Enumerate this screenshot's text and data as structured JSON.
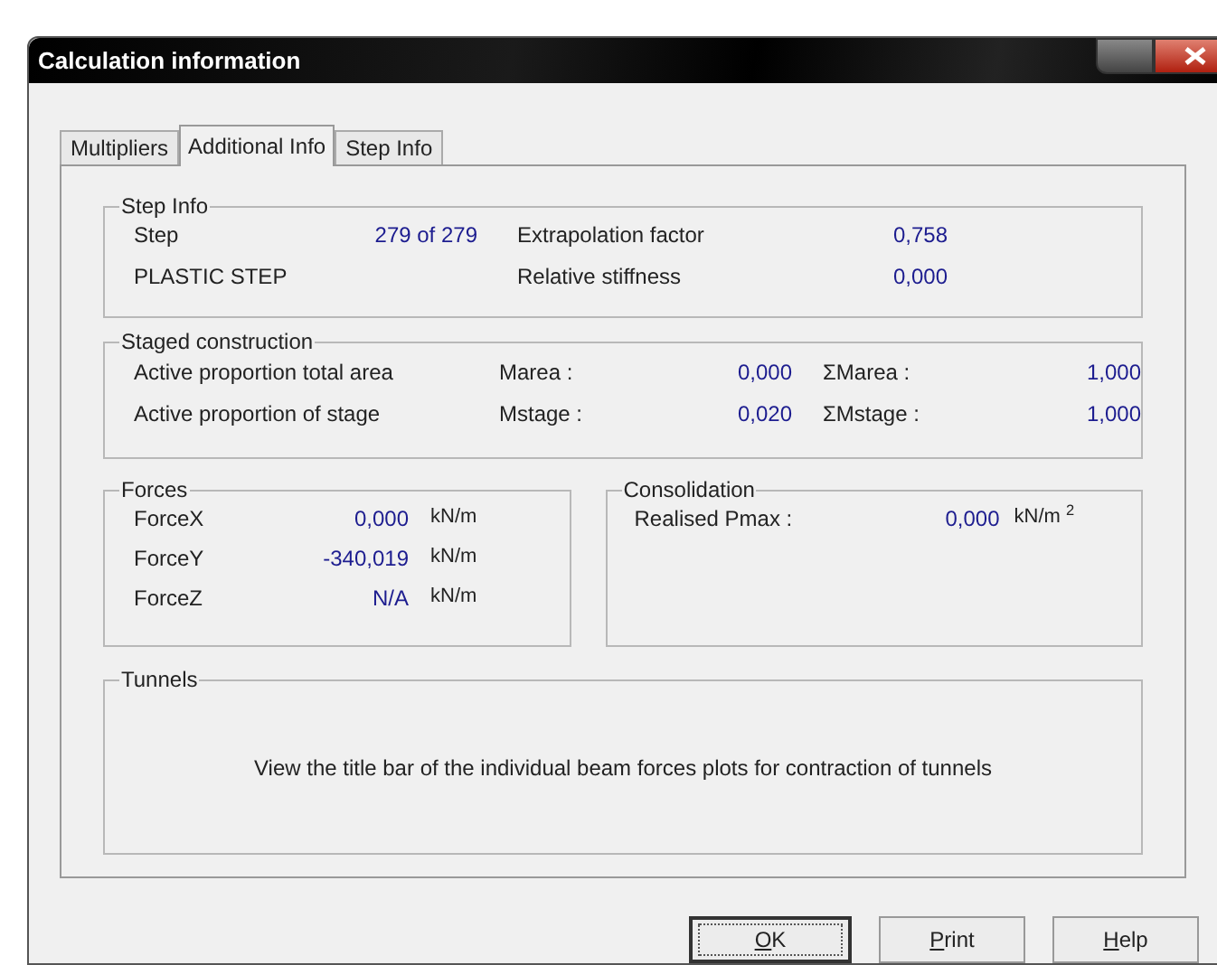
{
  "window": {
    "title": "Calculation information"
  },
  "tabs": [
    {
      "label": "Multipliers",
      "selected": false
    },
    {
      "label": "Additional Info",
      "selected": true
    },
    {
      "label": "Step Info",
      "selected": false
    }
  ],
  "step_info": {
    "title": "Step Info",
    "step_label": "Step",
    "step_value": "279 of 279",
    "phase": "PLASTIC STEP",
    "extrapolation_label": "Extrapolation factor",
    "extrapolation_value": "0,758",
    "stiffness_label": "Relative stiffness",
    "stiffness_value": "0,000"
  },
  "staged_construction": {
    "title": "Staged construction",
    "rows": [
      {
        "label": "Active proportion total area",
        "m_label": "Marea :",
        "m_value": "0,000",
        "sum_label": "ΣMarea :",
        "sum_value": "1,000"
      },
      {
        "label": "Active proportion of stage",
        "m_label": "Mstage :",
        "m_value": "0,020",
        "sum_label": "ΣMstage :",
        "sum_value": "1,000"
      }
    ]
  },
  "forces": {
    "title": "Forces",
    "rows": [
      {
        "label": "ForceX",
        "value": "0,000",
        "unit": "kN/m"
      },
      {
        "label": "ForceY",
        "value": "-340,019",
        "unit": "kN/m"
      },
      {
        "label": "ForceZ",
        "value": "N/A",
        "unit": "kN/m"
      }
    ]
  },
  "consolidation": {
    "title": "Consolidation",
    "label": "Realised Pmax :",
    "value": "0,000",
    "unit": "kN/m $^{2}$"
  },
  "tunnels": {
    "title": "Tunnels",
    "message": "View the title bar of the individual beam forces plots for contraction of tunnels"
  },
  "buttons": [
    {
      "accelerator": "O",
      "label": "K",
      "default": true
    },
    {
      "accelerator": "P",
      "label": "rint",
      "default": false
    },
    {
      "accelerator": "H",
      "label": "elp",
      "default": false
    }
  ]
}
